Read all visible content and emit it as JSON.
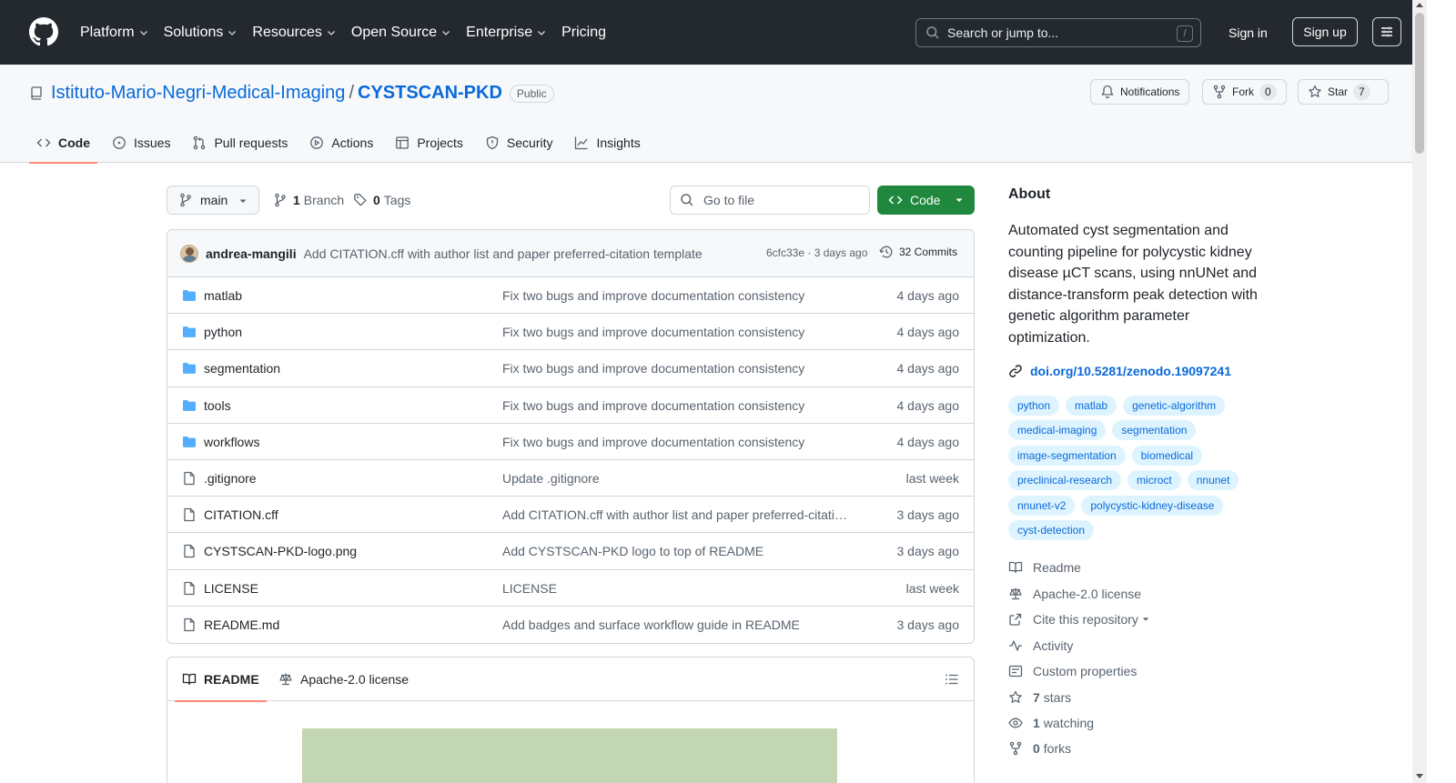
{
  "header": {
    "nav": [
      {
        "label": "Platform",
        "dropdown": true
      },
      {
        "label": "Solutions",
        "dropdown": true
      },
      {
        "label": "Resources",
        "dropdown": true
      },
      {
        "label": "Open Source",
        "dropdown": true
      },
      {
        "label": "Enterprise",
        "dropdown": true
      },
      {
        "label": "Pricing",
        "dropdown": false
      }
    ],
    "search_placeholder": "Search or jump to...",
    "search_key": "/",
    "signin": "Sign in",
    "signup": "Sign up"
  },
  "repo": {
    "owner": "Istituto-Mario-Negri-Medical-Imaging",
    "separator": "/",
    "name": "CYSTSCAN-PKD",
    "visibility": "Public",
    "notifications_label": "Notifications",
    "fork_label": "Fork",
    "fork_count": "0",
    "star_label": "Star",
    "star_count": "7",
    "tabs": [
      "Code",
      "Issues",
      "Pull requests",
      "Actions",
      "Projects",
      "Security",
      "Insights"
    ]
  },
  "toolbar": {
    "branch": "main",
    "branch_count": "1",
    "branch_label": "Branch",
    "tag_count": "0",
    "tag_label": "Tags",
    "goto_placeholder": "Go to file",
    "code_label": "Code"
  },
  "commit": {
    "author": "andrea-mangili",
    "message": "Add CITATION.cff with author list and paper preferred-citation template",
    "meta": "6cfc33e · 3 days ago",
    "commits_label": "32 Commits"
  },
  "files": [
    {
      "type": "dir",
      "name": "matlab",
      "message": "Fix two bugs and improve documentation consistency",
      "date": "4 days ago"
    },
    {
      "type": "dir",
      "name": "python",
      "message": "Fix two bugs and improve documentation consistency",
      "date": "4 days ago"
    },
    {
      "type": "dir",
      "name": "segmentation",
      "message": "Fix two bugs and improve documentation consistency",
      "date": "4 days ago"
    },
    {
      "type": "dir",
      "name": "tools",
      "message": "Fix two bugs and improve documentation consistency",
      "date": "4 days ago"
    },
    {
      "type": "dir",
      "name": "workflows",
      "message": "Fix two bugs and improve documentation consistency",
      "date": "4 days ago"
    },
    {
      "type": "file",
      "name": ".gitignore",
      "message": "Update .gitignore",
      "date": "last week"
    },
    {
      "type": "file",
      "name": "CITATION.cff",
      "message": "Add CITATION.cff with author list and paper preferred-citatio…",
      "date": "3 days ago"
    },
    {
      "type": "file",
      "name": "CYSTSCAN-PKD-logo.png",
      "message": "Add CYSTSCAN-PKD logo to top of README",
      "date": "3 days ago"
    },
    {
      "type": "file",
      "name": "LICENSE",
      "message": "LICENSE",
      "date": "last week"
    },
    {
      "type": "file",
      "name": "README.md",
      "message": "Add badges and surface workflow guide in README",
      "date": "3 days ago"
    }
  ],
  "readme": {
    "tab_readme": "README",
    "tab_license": "Apache-2.0 license"
  },
  "about": {
    "heading": "About",
    "description": "Automated cyst segmentation and counting pipeline for polycystic kidney disease µCT scans, using nnUNet and distance-transform peak detection with genetic algorithm parameter optimization.",
    "doi": "doi.org/10.5281/zenodo.19097241",
    "topics": [
      "python",
      "matlab",
      "genetic-algorithm",
      "medical-imaging",
      "segmentation",
      "image-segmentation",
      "biomedical",
      "preclinical-research",
      "microct",
      "nnunet",
      "nnunet-v2",
      "polycystic-kidney-disease",
      "cyst-detection"
    ],
    "readme": "Readme",
    "license": "Apache-2.0 license",
    "cite": "Cite this repository",
    "activity": "Activity",
    "custom_properties": "Custom properties",
    "stars_count": "7",
    "stars_label": "stars",
    "watching_count": "1",
    "watching_label": "watching",
    "forks_count": "0",
    "forks_label": "forks"
  },
  "colors": {
    "header_bg": "#24292f",
    "link": "#0969da",
    "code_button": "#1f883d",
    "active_tab": "#fd8c73",
    "folder": "#54aeff",
    "topic_bg": "#ddf4ff"
  }
}
